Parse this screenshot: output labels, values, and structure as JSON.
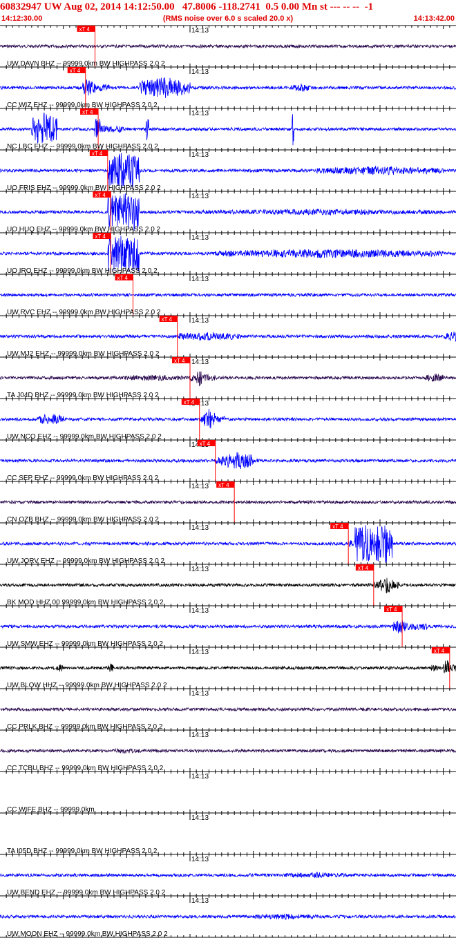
{
  "header": {
    "title": "60832947 UW Aug 02, 2014 14:12:50.00   47.8006 -118.2741  0.5 0.00 Mn st --- -- --  -1",
    "start_time": "14:12:30.00",
    "note": "(RMS noise over 6.0 s scaled 20.0 x)",
    "end_time": "14:13:42.00"
  },
  "minute_label": "14:13",
  "pick_label": "xT 4",
  "colors": {
    "header_red": "#e00000",
    "blue": "#0000ff",
    "purple": "#2a0a4e",
    "black": "#000000",
    "pick": "#ff0000"
  },
  "traces": [
    {
      "label": "UW DAVN BHZ -- 99999.0km BW  HIGHPASS  2.0  2",
      "color": "purple",
      "pick_s": 45.0,
      "bursts": []
    },
    {
      "label": "CC WIZ EHZ -- 99999.0km BW  HIGHPASS  2.0  2",
      "color": "blue",
      "pick_s": 43.5,
      "bursts": [
        [
          43,
          45,
          6
        ],
        [
          52,
          60,
          7
        ],
        [
          76,
          79,
          3
        ],
        [
          103,
          108,
          6
        ]
      ]
    },
    {
      "label": "NC LBC EHZ -- 99999.0km BW  HIGHPASS  2.0  2",
      "color": "blue",
      "pick_s": 45.5,
      "bursts": [
        [
          35,
          39,
          12
        ],
        [
          45,
          46,
          10
        ],
        [
          53,
          53.5,
          10
        ],
        [
          76,
          76.4,
          12
        ]
      ]
    },
    {
      "label": "UO FRIS EHZ -- 99999.0km BW  HIGHPASS  2.0  2",
      "color": "blue",
      "pick_s": 47.0,
      "bursts": [
        [
          47,
          52,
          20
        ],
        [
          80,
          100,
          3
        ]
      ]
    },
    {
      "label": "UO HUQ EHZ -- 99999.0km BW  HIGHPASS  2.0  2",
      "color": "blue",
      "pick_s": 47.5,
      "bursts": [
        [
          47,
          52,
          20
        ],
        [
          60,
          100,
          2
        ]
      ]
    },
    {
      "label": "UO IRO EHZ -- 99999.0km BW  HIGHPASS  2.0  2",
      "color": "blue",
      "pick_s": 47.5,
      "bursts": [
        [
          47,
          52,
          20
        ],
        [
          64,
          100,
          3
        ]
      ]
    },
    {
      "label": "UW RVC EHZ -- 99999.0km BW  HIGHPASS  2.0  2",
      "color": "blue",
      "pick_s": 51.0,
      "bursts": []
    },
    {
      "label": "UW MJ2 EHZ -- 99999.0km BW  HIGHPASS  2.0  2",
      "color": "blue",
      "pick_s": 58.0,
      "bursts": [
        [
          58,
          68,
          3
        ],
        [
          100,
          106,
          4
        ]
      ]
    },
    {
      "label": "TA J04D BHZ -- 99999.0km BW  HIGHPASS  2.0  2",
      "color": "purple",
      "pick_s": 60.0,
      "bursts": [
        [
          48,
          60,
          2
        ],
        [
          61,
          62,
          6
        ],
        [
          97,
          100,
          3
        ]
      ]
    },
    {
      "label": "UW NCO EHZ -- 99999.0km BW  HIGHPASS  2.0  2",
      "color": "blue",
      "pick_s": 61.5,
      "bursts": [
        [
          36,
          40,
          4
        ],
        [
          62,
          64,
          7
        ]
      ]
    },
    {
      "label": "CC SEP EHZ -- 99999.0km BW  HIGHPASS  2.0  2",
      "color": "blue",
      "pick_s": 64.0,
      "bursts": [
        [
          65,
          70,
          6
        ]
      ]
    },
    {
      "label": "CN OZB BHZ -- 99999.0km BW  HIGHPASS  2.0  2",
      "color": "purple",
      "pick_s": 67.0,
      "bursts": []
    },
    {
      "label": "UW JQRV EHZ -- 99999.0km BW  HIGHPASS  2.0  2",
      "color": "blue",
      "pick_s": 85.0,
      "bursts": [
        [
          86,
          92,
          18
        ]
      ]
    },
    {
      "label": "BK MOD HHZ 00 99999.0km BW  HIGHPASS  2.0  2",
      "color": "black",
      "pick_s": 89.0,
      "bursts": [
        [
          90,
          92,
          6
        ]
      ]
    },
    {
      "label": "UW SMW EHZ -- 99999.0km BW  HIGHPASS  2.0  2",
      "color": "blue",
      "pick_s": 93.5,
      "bursts": [
        [
          92,
          94,
          5
        ]
      ]
    },
    {
      "label": "UW BLOW HHZ -- 99999.0km BW  HIGHPASS  2.0  2",
      "color": "black",
      "pick_s": 101.0,
      "bursts": [
        [
          39,
          40,
          3
        ],
        [
          47,
          48,
          3
        ],
        [
          98,
          99,
          3
        ],
        [
          100,
          101,
          6
        ]
      ]
    },
    {
      "label": "CC PRLK BHZ -- 99999.0km BW  HIGHPASS  2.0  2",
      "color": "purple",
      "pick_s": null,
      "bursts": []
    },
    {
      "label": "CC TCBU BHZ -- 99999.0km BW  HIGHPASS  2.0  2",
      "color": "purple",
      "pick_s": null,
      "bursts": [
        [
          48,
          52,
          2
        ]
      ]
    },
    {
      "label": "CC WIFE BHZ -- 99999.0km",
      "color": "purple",
      "pick_s": null,
      "bursts": [],
      "flat": true
    },
    {
      "label": "TA I05D BHZ -- 99999.0km BW  HIGHPASS  2.0  2",
      "color": "purple",
      "pick_s": null,
      "bursts": [],
      "flat": true
    },
    {
      "label": "UW BEND EHZ -- 99999.0km BW  HIGHPASS  2.0  2",
      "color": "blue",
      "pick_s": null,
      "bursts": [
        [
          75,
          85,
          2
        ]
      ]
    },
    {
      "label": "UW MOON EHZ -- 99999.0km BW  HIGHPASS  2.0  2",
      "color": "blue",
      "pick_s": null,
      "bursts": [
        [
          70,
          80,
          2
        ]
      ]
    }
  ]
}
